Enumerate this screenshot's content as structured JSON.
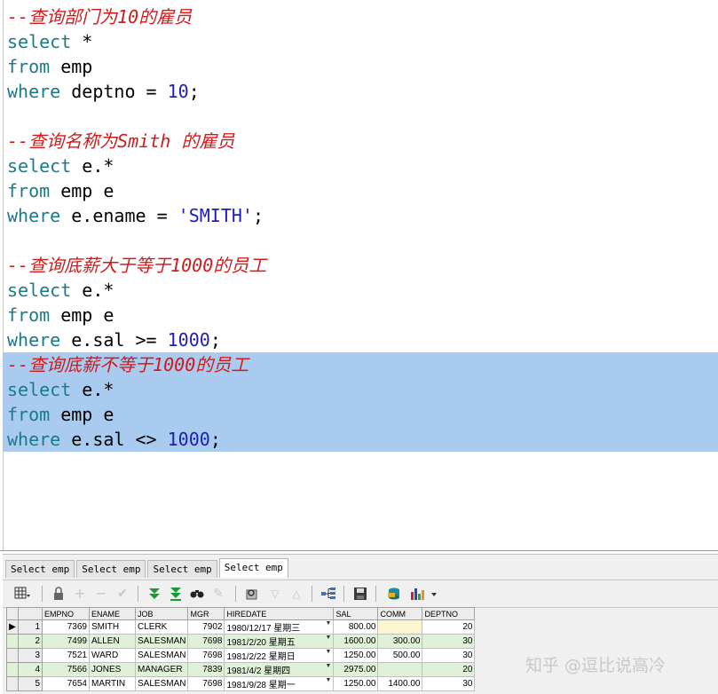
{
  "editor": {
    "blocks": [
      {
        "comment": "--查询部门为10的雇员",
        "select": "select",
        "select_rest": " *",
        "from": "from",
        "from_rest": " emp",
        "where": "where",
        "where_rest": " deptno = ",
        "where_val": "10",
        "where_end": ";"
      },
      {
        "comment": "--查询名称为Smith 的雇员",
        "select": "select",
        "select_rest": " e.*",
        "from": "from",
        "from_rest": " emp e",
        "where": "where",
        "where_rest": " e.ename = ",
        "where_val": "'SMITH'",
        "where_end": ";"
      },
      {
        "comment": "--查询底薪大于等于1000的员工",
        "select": "select",
        "select_rest": " e.*",
        "from": "from",
        "from_rest": " emp e",
        "where": "where",
        "where_rest": " e.sal >= ",
        "where_val": "1000",
        "where_end": ";"
      },
      {
        "comment": "--查询底薪不等于1000的员工",
        "select": "select",
        "select_rest": " e.*",
        "from": "from",
        "from_rest": " emp e",
        "where": "where",
        "where_rest": " e.sal <> ",
        "where_val": "1000",
        "where_end": ";"
      }
    ]
  },
  "tabs": [
    "Select emp",
    "Select emp",
    "Select emp",
    "Select emp"
  ],
  "toolbar": {
    "icons": [
      "grid-menu-icon",
      "lock-icon",
      "add-row-icon",
      "delete-row-icon",
      "post-icon",
      "fetch-next-icon",
      "fetch-last-icon",
      "find-icon",
      "clear-icon",
      "query-by-example-icon",
      "sort-desc-icon",
      "sort-asc-icon",
      "tree-icon",
      "save-icon",
      "export-icon",
      "chart-icon"
    ]
  },
  "grid": {
    "columns": [
      "EMPNO",
      "ENAME",
      "JOB",
      "MGR",
      "HIREDATE",
      "SAL",
      "COMM",
      "DEPTNO"
    ],
    "rows": [
      {
        "n": "1",
        "empno": "7369",
        "ename": "SMITH",
        "job": "CLERK",
        "mgr": "7902",
        "hiredate": "1980/12/17 星期三",
        "sal": "800.00",
        "comm": "",
        "deptno": "20"
      },
      {
        "n": "2",
        "empno": "7499",
        "ename": "ALLEN",
        "job": "SALESMAN",
        "mgr": "7698",
        "hiredate": "1981/2/20 星期五",
        "sal": "1600.00",
        "comm": "300.00",
        "deptno": "30"
      },
      {
        "n": "3",
        "empno": "7521",
        "ename": "WARD",
        "job": "SALESMAN",
        "mgr": "7698",
        "hiredate": "1981/2/22 星期日",
        "sal": "1250.00",
        "comm": "500.00",
        "deptno": "30"
      },
      {
        "n": "4",
        "empno": "7566",
        "ename": "JONES",
        "job": "MANAGER",
        "mgr": "7839",
        "hiredate": "1981/4/2 星期四",
        "sal": "2975.00",
        "comm": "",
        "deptno": "20"
      },
      {
        "n": "5",
        "empno": "7654",
        "ename": "MARTIN",
        "job": "SALESMAN",
        "mgr": "7698",
        "hiredate": "1981/9/28 星期一",
        "sal": "1250.00",
        "comm": "1400.00",
        "deptno": "30"
      }
    ]
  },
  "watermark": "知乎 @逗比说高冷",
  "colors": {
    "comment": "#d11a1a",
    "keyword": "#1a7a8a",
    "literal": "#1c1cc0",
    "selection": "#a8cbef",
    "alt_row": "#dff2d8"
  }
}
